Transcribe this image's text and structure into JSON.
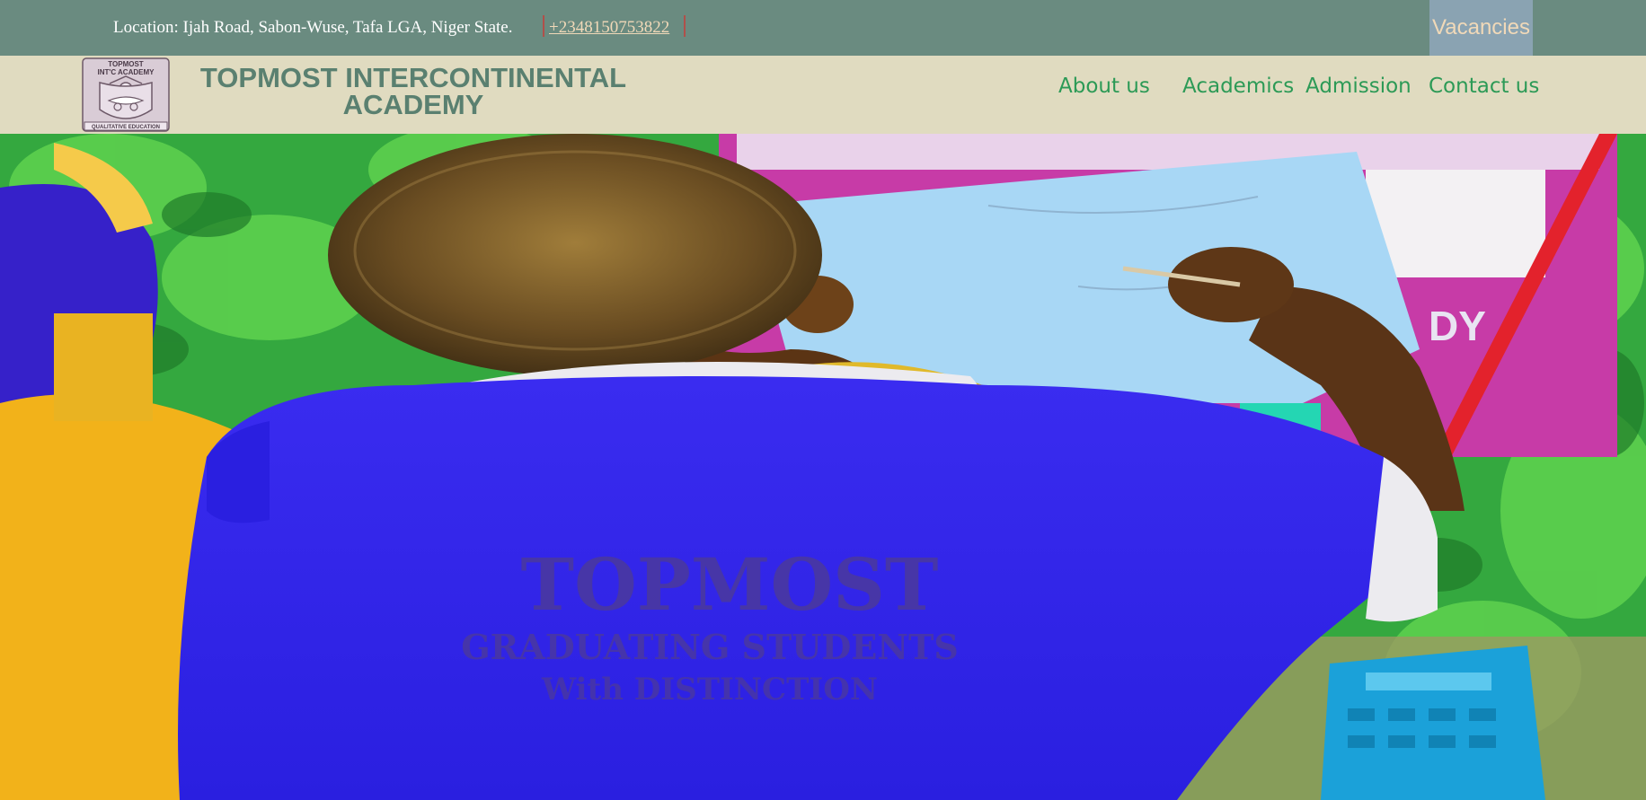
{
  "topbar": {
    "location": "Location: Ijah Road, Sabon-Wuse, Tafa LGA, Niger State.",
    "phone": "+2348150753822",
    "vacancies": "Vacancies"
  },
  "header": {
    "brand_line1": "TOPMOST INTERCONTINENTAL",
    "brand_line2": "ACADEMY",
    "logo": {
      "top_text_1": "TOPMOST",
      "top_text_2": "INT'C ACADEMY",
      "motto": "QUALITATIVE EDUCATION"
    }
  },
  "nav": {
    "items": [
      {
        "label": "About us"
      },
      {
        "label": "Academics"
      },
      {
        "label": "Admission"
      },
      {
        "label": "Contact us"
      }
    ]
  },
  "hero": {
    "shirt_line1": "TOPMOST",
    "shirt_line2": "GRADUATING STUDENTS",
    "shirt_line3": "With DISTINCTION"
  },
  "colors": {
    "topbar_bg": "#6a8b80",
    "navbar_bg": "#e0dbc0",
    "nav_link": "#2c9a56",
    "brand_text": "#5a8070",
    "vacancies_bg": "#8aa3b2",
    "phone_link": "#f1d9b8"
  }
}
